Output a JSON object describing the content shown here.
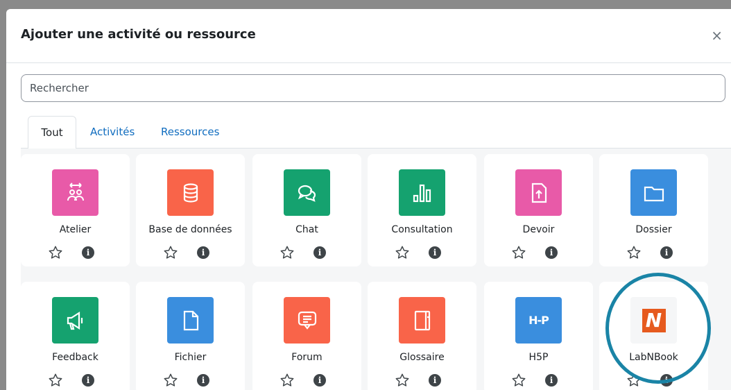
{
  "modal": {
    "title": "Ajouter une activité ou ressource",
    "close_label": "×"
  },
  "search": {
    "placeholder": "Rechercher",
    "value": ""
  },
  "tabs": [
    {
      "label": "Tout",
      "active": true
    },
    {
      "label": "Activités",
      "active": false
    },
    {
      "label": "Ressources",
      "active": false
    }
  ],
  "modules": [
    {
      "label": "Atelier",
      "icon": "workshop-icon",
      "color": "#e85aa8"
    },
    {
      "label": "Base de données",
      "icon": "database-icon",
      "color": "#f96449"
    },
    {
      "label": "Chat",
      "icon": "chat-icon",
      "color": "#15a26f"
    },
    {
      "label": "Consultation",
      "icon": "bar-chart-icon",
      "color": "#15a26f"
    },
    {
      "label": "Devoir",
      "icon": "assignment-icon",
      "color": "#e85aa8"
    },
    {
      "label": "Dossier",
      "icon": "folder-icon",
      "color": "#3a8ede"
    },
    {
      "label": "Feedback",
      "icon": "megaphone-icon",
      "color": "#15a26f"
    },
    {
      "label": "Fichier",
      "icon": "file-icon",
      "color": "#3a8ede"
    },
    {
      "label": "Forum",
      "icon": "forum-icon",
      "color": "#f96449"
    },
    {
      "label": "Glossaire",
      "icon": "notebook-icon",
      "color": "#f96449"
    },
    {
      "label": "H5P",
      "icon": "h5p-logo-icon",
      "color": "#3a8ede",
      "icon_text": "H-P"
    },
    {
      "label": "LabNBook",
      "icon": "labnbook-logo-icon",
      "color": "#f5f6f7",
      "icon_text": "N"
    }
  ],
  "colors": {
    "link": "#0f6cbf",
    "highlight": "#1a84a6",
    "info_badge": "#3e4448"
  }
}
